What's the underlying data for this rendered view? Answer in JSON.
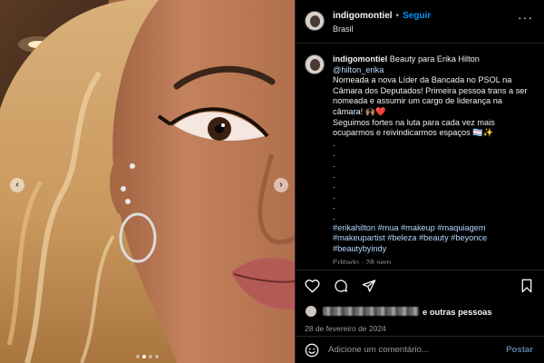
{
  "media": {
    "prev_glyph": "‹",
    "next_glyph": "›",
    "carousel_count": 4,
    "carousel_active": 1
  },
  "header": {
    "username": "indigomontiel",
    "separator": "•",
    "follow_label": "Seguir",
    "location": "Brasil",
    "more_glyph": "···"
  },
  "caption": {
    "username": "indigomontiel",
    "first_text": "Beauty para Erika Hilton",
    "mention": "@hilton_erika",
    "body": "Nomeada a nova Líder da Bancada no PSOL na Câmara dos Deputados! Primeira pessoa trans a ser nomeada e assumir um cargo de liderança na câmara! 🙌🏽❤️",
    "body2": "Seguimos fortes na luta para cada vez mais ocuparmos e reivindicarmos espaços 🏳️‍⚧️✨",
    "dots": [
      ".",
      ".",
      ".",
      ".",
      ".",
      ".",
      ".",
      "."
    ],
    "hashtags": "#erikahilton #mua #makeup #maquiagem #makeupartist #beleza #beauty #beyonce #beautybyindy",
    "edited": "Editado · 28 sem"
  },
  "likes": {
    "rest_label": "e outras pessoas"
  },
  "date": "28 de fevereiro de 2024",
  "comment": {
    "placeholder": "Adicione um comentário...",
    "post_label": "Postar"
  },
  "icons": {
    "like": "heart-icon",
    "comment": "comment-icon",
    "share": "share-icon",
    "save": "bookmark-icon",
    "emoji": "emoji-icon"
  }
}
